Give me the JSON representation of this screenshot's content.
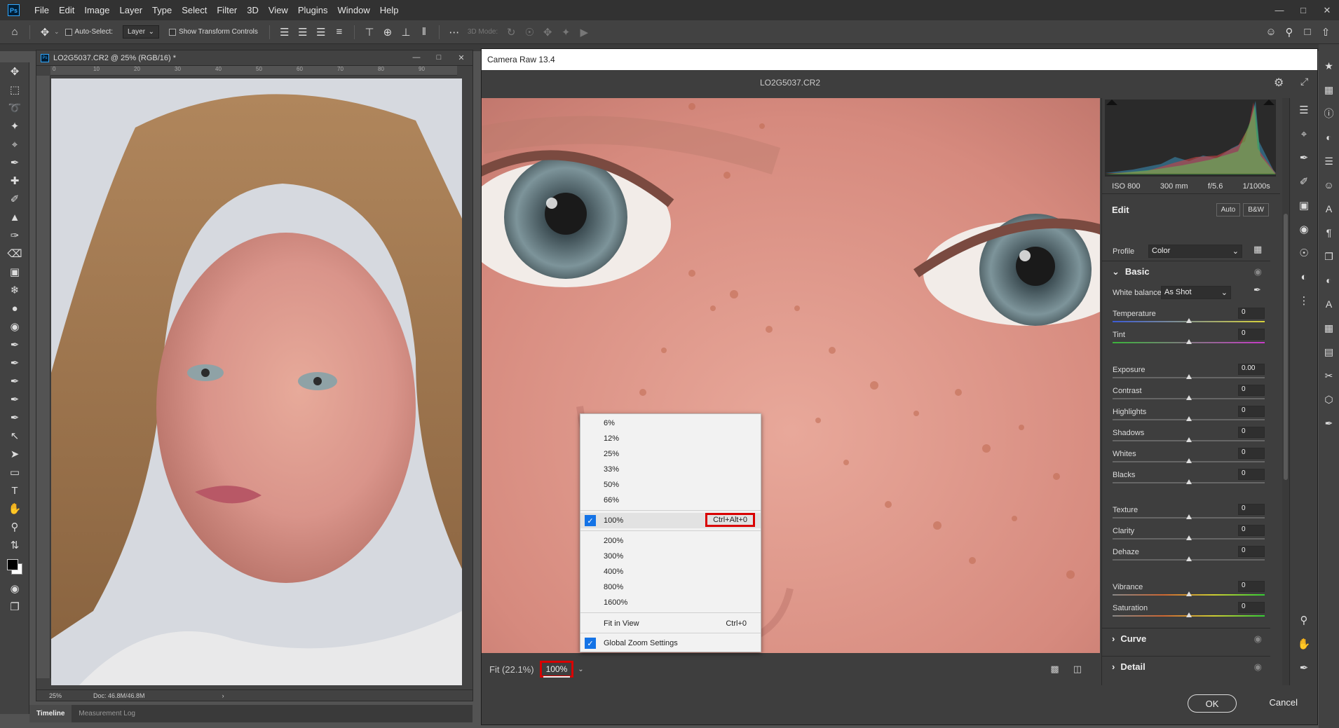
{
  "menubar": {
    "app_icon": "Ps",
    "items": [
      "File",
      "Edit",
      "Image",
      "Layer",
      "Type",
      "Select",
      "Filter",
      "3D",
      "View",
      "Plugins",
      "Window",
      "Help"
    ]
  },
  "optionsbar": {
    "auto_select_label": "Auto-Select:",
    "layer_select": "Layer",
    "transform_label": "Show Transform Controls",
    "threeD_mode": "3D Mode:"
  },
  "document": {
    "title": "LO2G5037.CR2 @ 25% (RGB/16) *",
    "ruler_ticks": [
      "0",
      "10",
      "20",
      "30",
      "40",
      "50",
      "60",
      "70",
      "80",
      "90"
    ],
    "zoom": "25%",
    "doc_size": "Doc: 46.8M/46.8M"
  },
  "bottom_tabs": [
    "Timeline",
    "Measurement Log"
  ],
  "camera_raw": {
    "title": "Camera Raw 13.4",
    "filename": "LO2G5037.CR2",
    "fit_label": "Fit (22.1%)",
    "zoom_value": "100%",
    "ok": "OK",
    "cancel": "Cancel",
    "exif": [
      "ISO 800",
      "300 mm",
      "f/5.6",
      "1/1000s"
    ],
    "edit": {
      "title": "Edit",
      "auto": "Auto",
      "bw": "B&W"
    },
    "profile": {
      "label": "Profile",
      "value": "Color"
    },
    "basic": {
      "title": "Basic",
      "white_balance_label": "White balance",
      "white_balance_value": "As Shot",
      "sliders": [
        {
          "label": "Temperature",
          "value": "0"
        },
        {
          "label": "Tint",
          "value": "0"
        },
        {
          "label": "Exposure",
          "value": "0.00"
        },
        {
          "label": "Contrast",
          "value": "0"
        },
        {
          "label": "Highlights",
          "value": "0"
        },
        {
          "label": "Shadows",
          "value": "0"
        },
        {
          "label": "Whites",
          "value": "0"
        },
        {
          "label": "Blacks",
          "value": "0"
        },
        {
          "label": "Texture",
          "value": "0"
        },
        {
          "label": "Clarity",
          "value": "0"
        },
        {
          "label": "Dehaze",
          "value": "0"
        },
        {
          "label": "Vibrance",
          "value": "0"
        },
        {
          "label": "Saturation",
          "value": "0"
        }
      ]
    },
    "sections": [
      "Curve",
      "Detail"
    ]
  },
  "zoom_menu": {
    "items_top": [
      "6%",
      "12%",
      "25%",
      "33%",
      "50%",
      "66%"
    ],
    "checked_item": "100%",
    "checked_shortcut": "Ctrl+Alt+0",
    "items_mid": [
      "200%",
      "300%",
      "400%",
      "800%",
      "1600%"
    ],
    "fit_in_view": "Fit in View",
    "fit_shortcut": "Ctrl+0",
    "global_zoom": "Global Zoom Settings"
  },
  "colors": {
    "highlight_red": "#d90000",
    "check_blue": "#1473e6"
  }
}
